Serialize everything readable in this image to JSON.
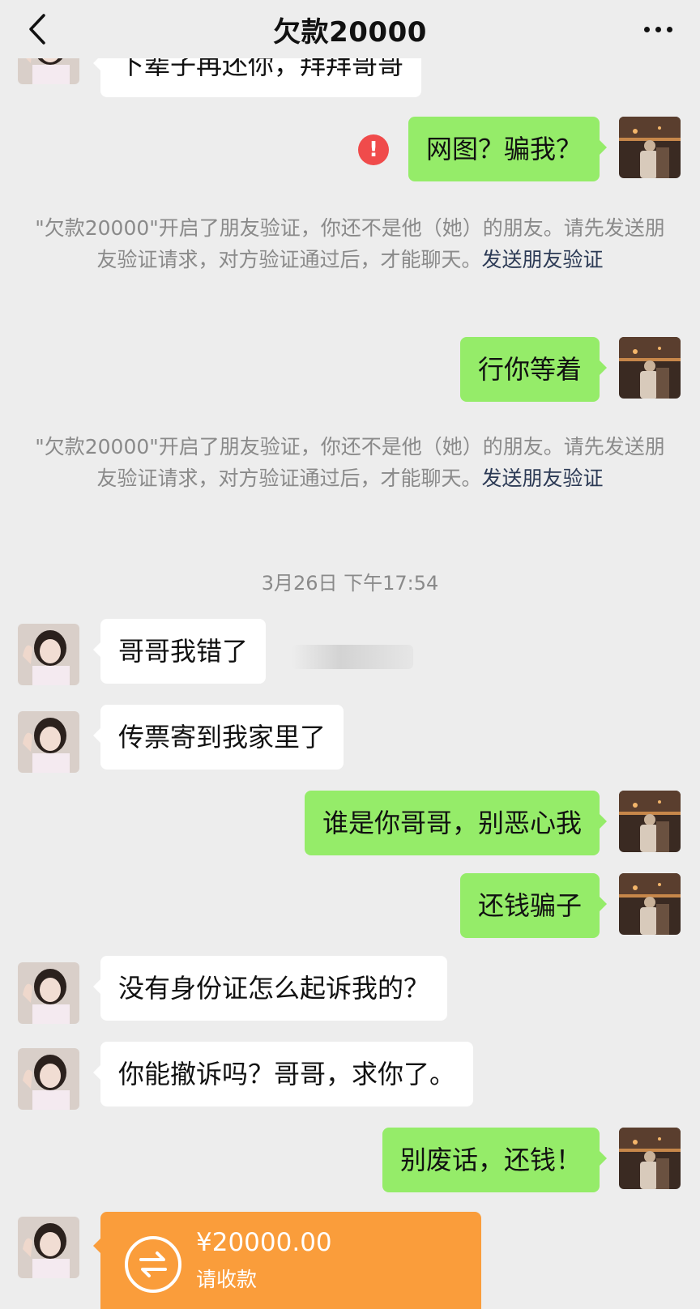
{
  "header": {
    "title": "欠款20000",
    "back_icon": "chevron-left-icon",
    "more_icon": "more-dots-icon"
  },
  "colors": {
    "background": "#ededed",
    "outgoing_bubble": "#95ec69",
    "incoming_bubble": "#ffffff",
    "transfer_card": "#fa9d3b",
    "error_badge": "#f04b4b",
    "link": "#2c3a55"
  },
  "messages": {
    "m0_partial": "下辈子再还你，拜拜哥哥",
    "m1": "网图？骗我？",
    "m2": "行你等着",
    "m3": "哥哥我错了",
    "m4": "传票寄到我家里了",
    "m5": "谁是你哥哥，别恶心我",
    "m6": "还钱骗子",
    "m7": "没有身份证怎么起诉我的？",
    "m8": "你能撤诉吗？哥哥，求你了。",
    "m9": "别废话，还钱！"
  },
  "system_notice": {
    "text": "\"欠款20000\"开启了朋友验证，你还不是他（她）的朋友。请先发送朋友验证请求，对方验证通过后，才能聊天。",
    "link": "发送朋友验证"
  },
  "error_badge_text": "!",
  "timestamp": "3月26日 下午17:54",
  "transfer": {
    "amount": "¥20000.00",
    "label": "请收款",
    "icon": "transfer-arrows-icon"
  }
}
